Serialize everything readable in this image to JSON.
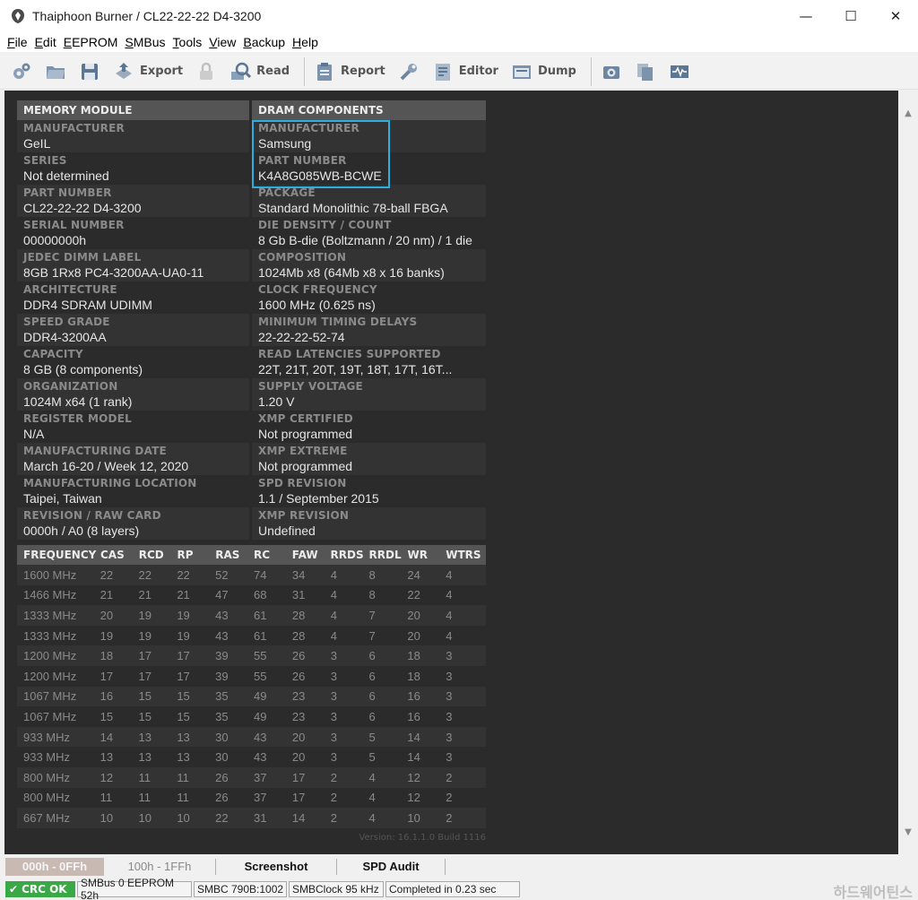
{
  "window": {
    "title": "Thaiphoon Burner / CL22-22-22 D4-3200",
    "minimize": "—",
    "maximize": "☐",
    "close": "✕"
  },
  "menu": {
    "items": [
      {
        "key": "F",
        "rest": "ile"
      },
      {
        "key": "E",
        "rest": "dit"
      },
      {
        "key": "E",
        "rest": "EPROM"
      },
      {
        "key": "S",
        "rest": "MBus"
      },
      {
        "key": "T",
        "rest": "ools"
      },
      {
        "key": "V",
        "rest": "iew"
      },
      {
        "key": "B",
        "rest": "ackup"
      },
      {
        "key": "H",
        "rest": "elp"
      }
    ]
  },
  "toolbar": {
    "export": "Export",
    "read": "Read",
    "report": "Report",
    "editor": "Editor",
    "dump": "Dump"
  },
  "module": {
    "header": "MEMORY MODULE",
    "fields": [
      {
        "label": "MANUFACTURER",
        "value": "GeIL"
      },
      {
        "label": "SERIES",
        "value": "Not determined"
      },
      {
        "label": "PART NUMBER",
        "value": "CL22-22-22 D4-3200"
      },
      {
        "label": "SERIAL NUMBER",
        "value": "00000000h"
      },
      {
        "label": "JEDEC DIMM LABEL",
        "value": "8GB 1Rx8 PC4-3200AA-UA0-11"
      },
      {
        "label": "ARCHITECTURE",
        "value": "DDR4 SDRAM UDIMM"
      },
      {
        "label": "SPEED GRADE",
        "value": "DDR4-3200AA"
      },
      {
        "label": "CAPACITY",
        "value": "8 GB (8 components)"
      },
      {
        "label": "ORGANIZATION",
        "value": "1024M x64 (1 rank)"
      },
      {
        "label": "REGISTER MODEL",
        "value": "N/A"
      },
      {
        "label": "MANUFACTURING DATE",
        "value": "March 16-20 / Week 12, 2020"
      },
      {
        "label": "MANUFACTURING LOCATION",
        "value": "Taipei, Taiwan"
      },
      {
        "label": "REVISION / RAW CARD",
        "value": "0000h / A0 (8 layers)"
      }
    ]
  },
  "dram": {
    "header": "DRAM COMPONENTS",
    "fields": [
      {
        "label": "MANUFACTURER",
        "value": "Samsung"
      },
      {
        "label": "PART NUMBER",
        "value": "K4A8G085WB-BCWE"
      },
      {
        "label": "PACKAGE",
        "value": "Standard Monolithic 78-ball FBGA"
      },
      {
        "label": "DIE DENSITY / COUNT",
        "value": "8 Gb B-die (Boltzmann / 20 nm) / 1 die"
      },
      {
        "label": "COMPOSITION",
        "value": "1024Mb x8 (64Mb x8 x 16 banks)"
      },
      {
        "label": "CLOCK FREQUENCY",
        "value": "1600 MHz (0.625 ns)"
      },
      {
        "label": "MINIMUM TIMING DELAYS",
        "value": "22-22-22-52-74"
      },
      {
        "label": "READ LATENCIES SUPPORTED",
        "value": "22T, 21T, 20T, 19T, 18T, 17T, 16T..."
      },
      {
        "label": "SUPPLY VOLTAGE",
        "value": "1.20 V"
      },
      {
        "label": "XMP CERTIFIED",
        "value": "Not programmed"
      },
      {
        "label": "XMP EXTREME",
        "value": "Not programmed"
      },
      {
        "label": "SPD REVISION",
        "value": "1.1 / September 2015"
      },
      {
        "label": "XMP REVISION",
        "value": "Undefined"
      }
    ]
  },
  "timings": {
    "columns": [
      "FREQUENCY",
      "CAS",
      "RCD",
      "RP",
      "RAS",
      "RC",
      "FAW",
      "RRDS",
      "RRDL",
      "WR",
      "WTRS"
    ],
    "rows": [
      [
        "1600 MHz",
        "22",
        "22",
        "22",
        "52",
        "74",
        "34",
        "4",
        "8",
        "24",
        "4"
      ],
      [
        "1466 MHz",
        "21",
        "21",
        "21",
        "47",
        "68",
        "31",
        "4",
        "8",
        "22",
        "4"
      ],
      [
        "1333 MHz",
        "20",
        "19",
        "19",
        "43",
        "61",
        "28",
        "4",
        "7",
        "20",
        "4"
      ],
      [
        "1333 MHz",
        "19",
        "19",
        "19",
        "43",
        "61",
        "28",
        "4",
        "7",
        "20",
        "4"
      ],
      [
        "1200 MHz",
        "18",
        "17",
        "17",
        "39",
        "55",
        "26",
        "3",
        "6",
        "18",
        "3"
      ],
      [
        "1200 MHz",
        "17",
        "17",
        "17",
        "39",
        "55",
        "26",
        "3",
        "6",
        "18",
        "3"
      ],
      [
        "1067 MHz",
        "16",
        "15",
        "15",
        "35",
        "49",
        "23",
        "3",
        "6",
        "16",
        "3"
      ],
      [
        "1067 MHz",
        "15",
        "15",
        "15",
        "35",
        "49",
        "23",
        "3",
        "6",
        "16",
        "3"
      ],
      [
        "933 MHz",
        "14",
        "13",
        "13",
        "30",
        "43",
        "20",
        "3",
        "5",
        "14",
        "3"
      ],
      [
        "933 MHz",
        "13",
        "13",
        "13",
        "30",
        "43",
        "20",
        "3",
        "5",
        "14",
        "3"
      ],
      [
        "800 MHz",
        "12",
        "11",
        "11",
        "26",
        "37",
        "17",
        "2",
        "4",
        "12",
        "2"
      ],
      [
        "800 MHz",
        "11",
        "11",
        "11",
        "26",
        "37",
        "17",
        "2",
        "4",
        "12",
        "2"
      ],
      [
        "667 MHz",
        "10",
        "10",
        "10",
        "22",
        "31",
        "14",
        "2",
        "4",
        "10",
        "2"
      ]
    ]
  },
  "version": "Version: 16.1.1.0 Build 1116",
  "tabs": {
    "t1": "000h - 0FFh",
    "t2": "100h - 1FFh",
    "screenshot": "Screenshot",
    "spd_audit": "SPD Audit"
  },
  "status": {
    "crc": "CRC OK",
    "smbus": "SMBus 0 EEPROM 52h",
    "smbc": "SMBC 790B:1002",
    "clock": "SMBClock 95 kHz",
    "completed": "Completed in 0.23 sec"
  },
  "watermark": "하드웨어틴스",
  "colors": {
    "accent_highlight": "#2ab0e0",
    "crc_ok": "#3aa845",
    "panel_bg": "#2b2b2b",
    "header_bg": "#555555"
  }
}
